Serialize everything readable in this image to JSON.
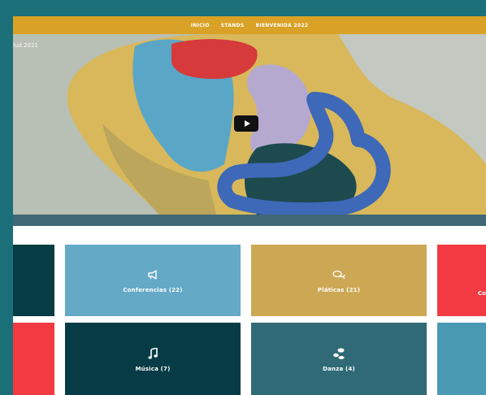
{
  "navbar": {
    "items": [
      {
        "label": "INICIO"
      },
      {
        "label": "STANDS"
      },
      {
        "label": "BIENVENIDA 2022"
      }
    ]
  },
  "video": {
    "title_fragment": "lud 2021",
    "play_icon": "play-icon"
  },
  "categories": {
    "row1": [
      {
        "label": "",
        "color": "#063c43"
      },
      {
        "label": "Conferencias (22)",
        "icon": "megaphone-icon",
        "color": "#64a9c6"
      },
      {
        "label": "Pláticas (21)",
        "icon": "chat-bubbles-icon",
        "color": "#cca854"
      },
      {
        "label": "Co",
        "color": "#f23a42"
      }
    ],
    "row2": [
      {
        "label": "",
        "color": "#f23a42"
      },
      {
        "label": "Música (7)",
        "icon": "music-note-icon",
        "color": "#073c46"
      },
      {
        "label": "Danza (4)",
        "icon": "footsteps-icon",
        "color": "#2f6a76"
      },
      {
        "label": "",
        "color": "#4b9ab3"
      }
    ]
  },
  "colors": {
    "frame": "#1a6f78",
    "navbar": "#d9a226",
    "video_strip": "#3f6775"
  }
}
